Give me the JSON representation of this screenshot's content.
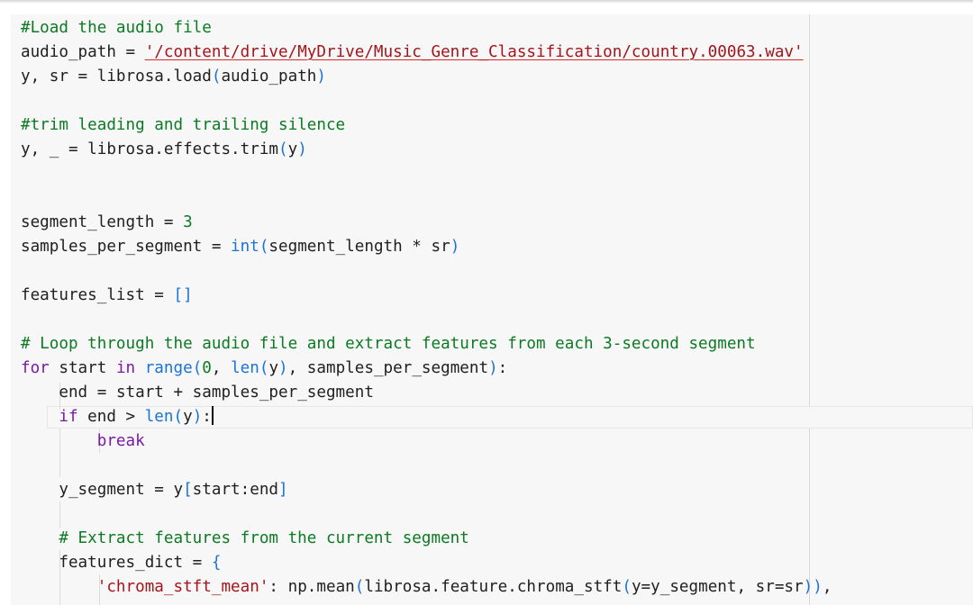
{
  "cell": {
    "language": "python",
    "lines": [
      {
        "tokens": [
          [
            "#Load the audio file",
            "c"
          ]
        ]
      },
      {
        "tokens": [
          [
            "audio_path",
            "v"
          ],
          [
            " = ",
            "o"
          ],
          [
            "'/content/drive/MyDrive/Music_Genre_Classification/country.00063.wav'",
            "s"
          ]
        ]
      },
      {
        "tokens": [
          [
            "y, sr",
            "v"
          ],
          [
            " = ",
            "o"
          ],
          [
            "librosa.load",
            "v"
          ],
          [
            "(",
            "p"
          ],
          [
            "audio_path",
            "v"
          ],
          [
            ")",
            "p"
          ]
        ]
      },
      {
        "tokens": []
      },
      {
        "tokens": [
          [
            "#trim leading and trailing silence",
            "c"
          ]
        ]
      },
      {
        "tokens": [
          [
            "y, _",
            "v"
          ],
          [
            " = ",
            "o"
          ],
          [
            "librosa.effects.trim",
            "v"
          ],
          [
            "(",
            "p"
          ],
          [
            "y",
            "v"
          ],
          [
            ")",
            "p"
          ]
        ]
      },
      {
        "tokens": []
      },
      {
        "tokens": []
      },
      {
        "tokens": [
          [
            "segment_length",
            "v"
          ],
          [
            " = ",
            "o"
          ],
          [
            "3",
            "n"
          ]
        ]
      },
      {
        "tokens": [
          [
            "samples_per_segment",
            "v"
          ],
          [
            " = ",
            "o"
          ],
          [
            "int",
            "b"
          ],
          [
            "(",
            "p"
          ],
          [
            "segment_length",
            "v"
          ],
          [
            " * ",
            "o"
          ],
          [
            "sr",
            "v"
          ],
          [
            ")",
            "p"
          ]
        ]
      },
      {
        "tokens": []
      },
      {
        "tokens": [
          [
            "features_list",
            "v"
          ],
          [
            " = ",
            "o"
          ],
          [
            "[]",
            "p"
          ]
        ]
      },
      {
        "tokens": []
      },
      {
        "tokens": [
          [
            "# Loop through the audio file and extract features from each 3-second segment",
            "c"
          ]
        ]
      },
      {
        "tokens": [
          [
            "for",
            "k"
          ],
          [
            " start ",
            "v"
          ],
          [
            "in",
            "k"
          ],
          [
            " ",
            "v"
          ],
          [
            "range",
            "b"
          ],
          [
            "(",
            "p"
          ],
          [
            "0",
            "n"
          ],
          [
            ", ",
            "v"
          ],
          [
            "len",
            "b"
          ],
          [
            "(",
            "p"
          ],
          [
            "y",
            "v"
          ],
          [
            ")",
            "p"
          ],
          [
            ", samples_per_segment",
            "v"
          ],
          [
            ")",
            "p"
          ],
          [
            ":",
            "v"
          ]
        ]
      },
      {
        "tokens": [
          [
            "    end",
            "v"
          ],
          [
            " = ",
            "o"
          ],
          [
            "start + samples_per_segment",
            "v"
          ]
        ]
      },
      {
        "tokens": [
          [
            "    ",
            "v"
          ],
          [
            "if",
            "k"
          ],
          [
            " end > ",
            "v"
          ],
          [
            "len",
            "b"
          ],
          [
            "(",
            "p"
          ],
          [
            "y",
            "v"
          ],
          [
            ")",
            "p"
          ],
          [
            ":",
            "v"
          ]
        ],
        "caret": true
      },
      {
        "tokens": [
          [
            "        ",
            "v"
          ],
          [
            "break",
            "k"
          ]
        ]
      },
      {
        "tokens": []
      },
      {
        "tokens": [
          [
            "    y_segment",
            "v"
          ],
          [
            " = ",
            "o"
          ],
          [
            "y",
            "v"
          ],
          [
            "[",
            "p"
          ],
          [
            "start:end",
            "v"
          ],
          [
            "]",
            "p"
          ]
        ]
      },
      {
        "tokens": []
      },
      {
        "tokens": [
          [
            "    ",
            "v"
          ],
          [
            "# Extract features from the current segment",
            "c"
          ]
        ]
      },
      {
        "tokens": [
          [
            "    features_dict",
            "v"
          ],
          [
            " = ",
            "o"
          ],
          [
            "{",
            "p"
          ]
        ]
      },
      {
        "tokens": [
          [
            "        ",
            "v"
          ],
          [
            "'chroma_stft_mean'",
            "s"
          ],
          [
            ": np.mean",
            "v"
          ],
          [
            "(",
            "p"
          ],
          [
            "librosa.feature.chroma_stft",
            "v"
          ],
          [
            "(",
            "p"
          ],
          [
            "y=y_segment, sr=sr",
            "v"
          ],
          [
            ")",
            "p"
          ],
          [
            ")",
            "p"
          ],
          [
            ",",
            "v"
          ]
        ]
      }
    ]
  }
}
